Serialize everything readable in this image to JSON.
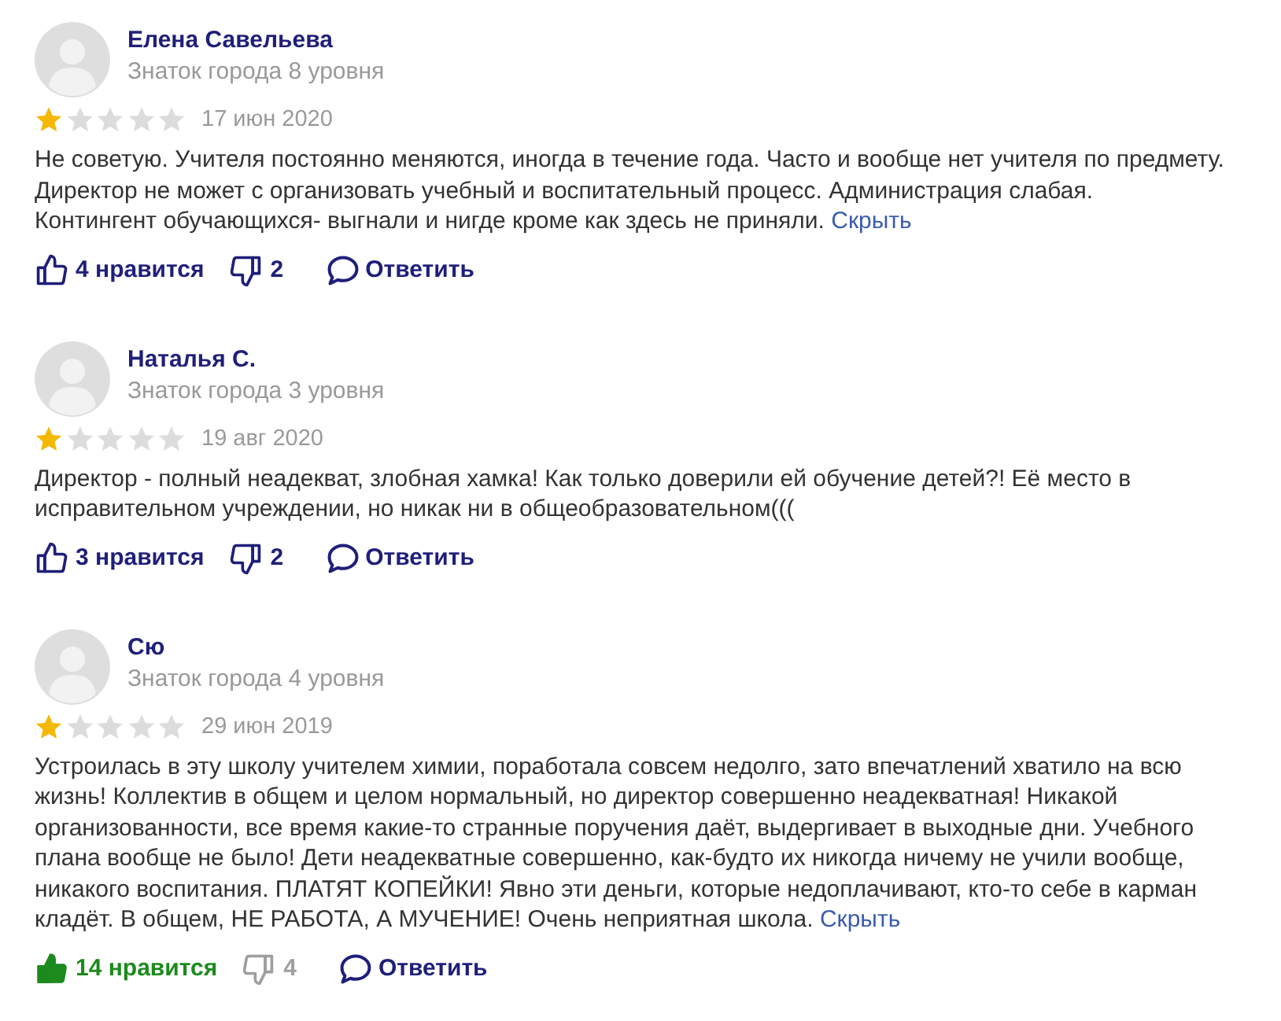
{
  "reviews": [
    {
      "author": "Елена Савельева",
      "rank": "Знаток города 8 уровня",
      "stars": 1,
      "date": "17 июн 2020",
      "text": "Не советую. Учителя постоянно меняются, иногда в течение года. Часто и вообще нет учителя по предмету. Директор не может с организовать учебный и воспитательный процесс. Администрация слабая.\nКонтингент обучающихся- выгнали и нигде кроме как здесь не приняли.",
      "collapse_link": "Скрыть",
      "like": {
        "label": "4 нравится",
        "selected": false
      },
      "dislike": {
        "label": "2",
        "selected": false
      },
      "reply": "Ответить"
    },
    {
      "author": "Наталья С.",
      "rank": "Знаток города 3 уровня",
      "stars": 1,
      "date": "19 авг 2020",
      "text": "Директор - полный неадекват, злобная хамка! Как только доверили ей обучение детей?! Её место в исправительном учреждении, но никак ни в общеобразовательном(((",
      "like": {
        "label": "3 нравится",
        "selected": false
      },
      "dislike": {
        "label": "2",
        "selected": false
      },
      "reply": "Ответить"
    },
    {
      "author": "Сю",
      "rank": "Знаток города 4 уровня",
      "stars": 1,
      "date": "29 июн 2019",
      "text": "Устроилась в эту школу учителем химии, поработала совсем недолго, зато впечатлений хватило на всю жизнь! Коллектив в общем и целом нормальный, но директор совершенно неадекватная! Никакой организованности, все время какие-то странные поручения даёт, выдергивает в выходные дни. Учебного плана вообще не было! Дети неадекватные совершенно, как-будто их никогда ничему не учили вообще, никакого воспитания. ПЛАТЯТ КОПЕЙКИ! Явно эти деньги, которые недоплачивают, кто-то себе в карман кладёт. В общем, НЕ РАБОТА, А МУЧЕНИЕ! Очень неприятная школа.",
      "collapse_link": "Скрыть",
      "like": {
        "label": "14 нравится",
        "selected": true
      },
      "dislike": {
        "label": "4",
        "selected": false
      },
      "reply": "Ответить"
    }
  ]
}
